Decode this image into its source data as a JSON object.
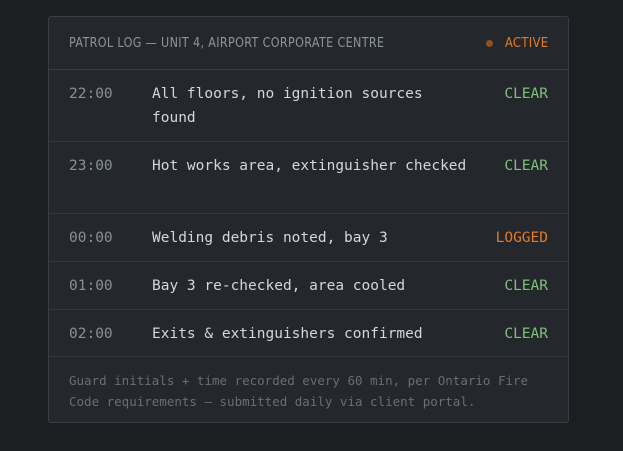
{
  "log": {
    "title": "PATROL LOG — UNIT 4, AIRPORT CORPORATE CENTRE",
    "status": "ACTIVE",
    "entries": [
      {
        "time": "22:00",
        "description": "All floors, no ignition sources found",
        "status": "CLEAR"
      },
      {
        "time": "23:00",
        "description": "Hot works area, extinguisher checked",
        "status": "CLEAR"
      },
      {
        "time": "00:00",
        "description": "Welding debris noted, bay 3",
        "status": "LOGGED"
      },
      {
        "time": "01:00",
        "description": "Bay 3 re-checked, area cooled",
        "status": "CLEAR"
      },
      {
        "time": "02:00",
        "description": "Exits & extinguishers confirmed",
        "status": "CLEAR"
      }
    ],
    "footer": "Guard initials + time recorded every 60 min, per Ontario Fire Code requirements — submitted daily via client portal."
  },
  "colors": {
    "background": "#1c1e21",
    "card": "#24272c",
    "active": "#e07b28",
    "clear": "#7fbf7a",
    "logged": "#e07b28"
  }
}
